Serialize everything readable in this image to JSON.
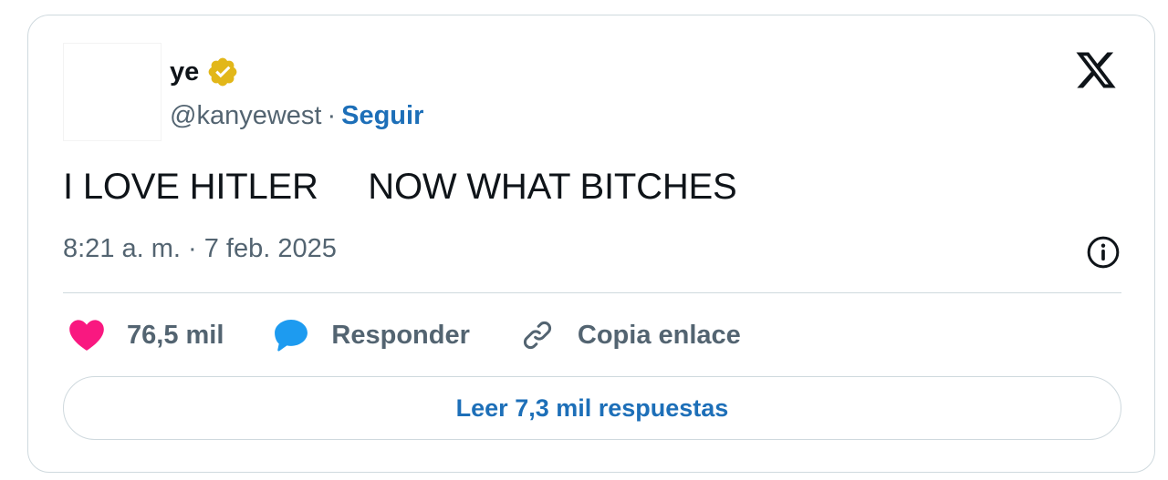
{
  "author": {
    "display_name": "ye",
    "handle": "@kanyewest",
    "separator": "·",
    "follow_label": "Seguir",
    "verified_color": "#e2b719"
  },
  "tweet": {
    "text": "I LOVE HITLER     NOW WHAT BITCHES",
    "timestamp": "8:21 a. m. · 7 feb. 2025"
  },
  "actions": {
    "likes_count": "76,5 mil",
    "reply_label": "Responder",
    "copy_link_label": "Copia enlace"
  },
  "read_replies_label": "Leer 7,3 mil respuestas",
  "colors": {
    "heart": "#f91880",
    "reply": "#1d9bf0",
    "link": "#1d6fb8",
    "muted": "#536471"
  }
}
